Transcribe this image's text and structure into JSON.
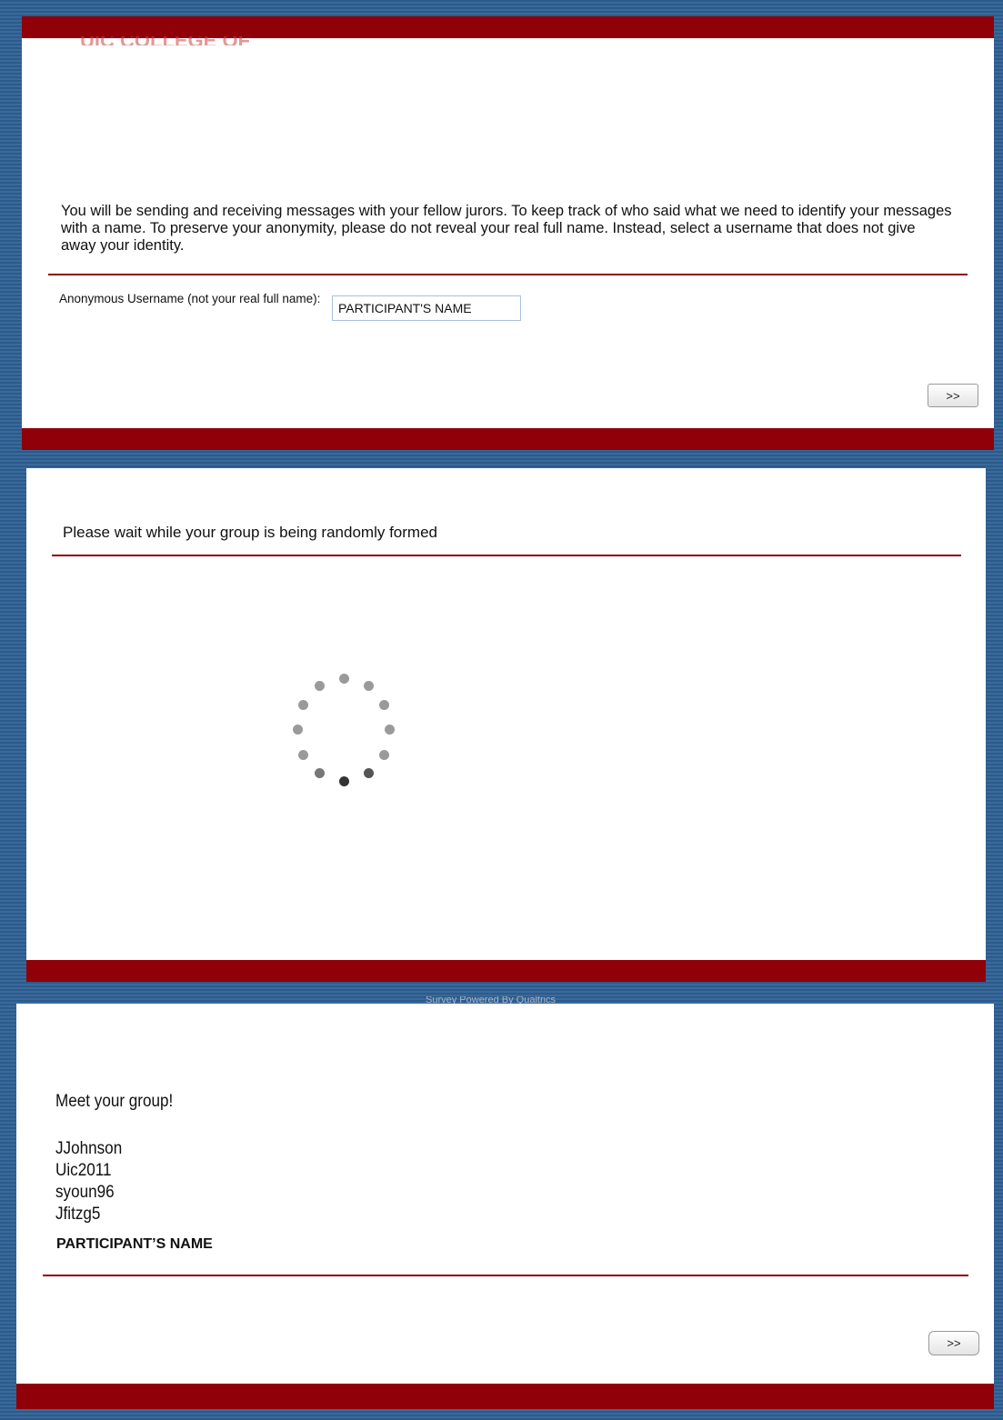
{
  "screen1": {
    "header_logo": "UIC COLLEGE OF",
    "instructions": "You will be sending and receiving messages with your fellow jurors. To keep track of who said what we need to identify your messages with a name. To preserve your anonymity, please do not reveal your real full name. Instead, select a username that does not give away your identity.",
    "username_label": "Anonymous Username (not your real full name):",
    "username_value": "PARTICIPANT'S NAME",
    "next_button": ">>"
  },
  "screen2": {
    "wait_message": "Please wait while your group is being randomly formed",
    "footer_text": "Survey Powered By Qualtrics"
  },
  "screen3": {
    "heading": "Meet your group!",
    "members": [
      "JJohnson",
      "Uic2011",
      "syoun96",
      "Jfitzg5"
    ],
    "participant": "PARTICIPANT’S NAME",
    "next_button": ">>"
  },
  "colors": {
    "bar": "#8f0008",
    "background": "#2c5a8a"
  }
}
